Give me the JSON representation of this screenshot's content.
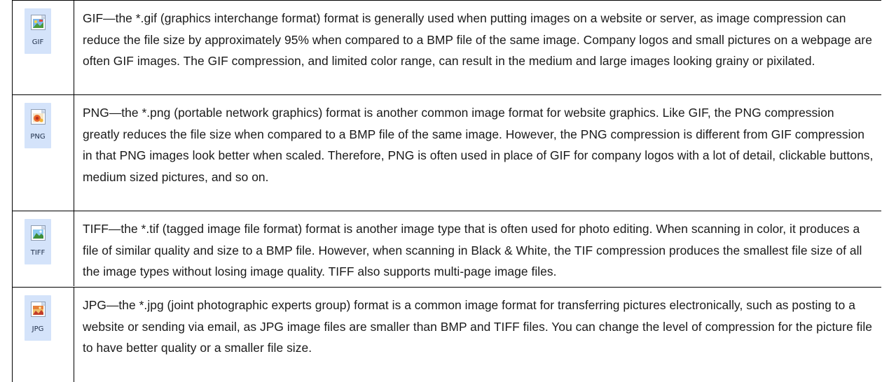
{
  "formats": [
    {
      "label": "GIF",
      "icon": "gif-file-icon",
      "text": "GIF—the *.gif (graphics interchange format) format is generally used when putting images on a website or server, as image compression can reduce the file size by approximately 95% when compared to a BMP file of the same image. Company logos and small pictures on a webpage are often GIF images. The GIF compression, and limited color range, can result in the medium and large images looking grainy or pixilated."
    },
    {
      "label": "PNG",
      "icon": "png-file-icon",
      "text": "PNG—the *.png (portable network graphics) format is another common image format for website graphics. Like GIF, the PNG compression greatly reduces the file size when compared to a BMP file of the same image. However, the PNG compression is different from GIF compression in that PNG images look better when scaled. Therefore, PNG is often used in place of GIF for company logos with a lot of detail, clickable buttons, medium sized pictures, and so on."
    },
    {
      "label": "TIFF",
      "icon": "tiff-file-icon",
      "text": "TIFF—the *.tif (tagged image file format) format is another image type that is often used for photo editing. When scanning in color, it produces a file of similar quality and size to a BMP file. However, when scanning in Black & White, the TIF compression produces the smallest file size of all the image types without losing image quality. TIFF also supports multi-page image files."
    },
    {
      "label": "JPG",
      "icon": "jpg-file-icon",
      "text": "JPG—the *.jpg (joint photographic experts group) format is a common image format for transferring pictures electronically, such as posting to a website or sending via email, as JPG image files are smaller than BMP and TIFF files. You can change the level of compression for the picture file to have better quality or a smaller file size."
    }
  ]
}
